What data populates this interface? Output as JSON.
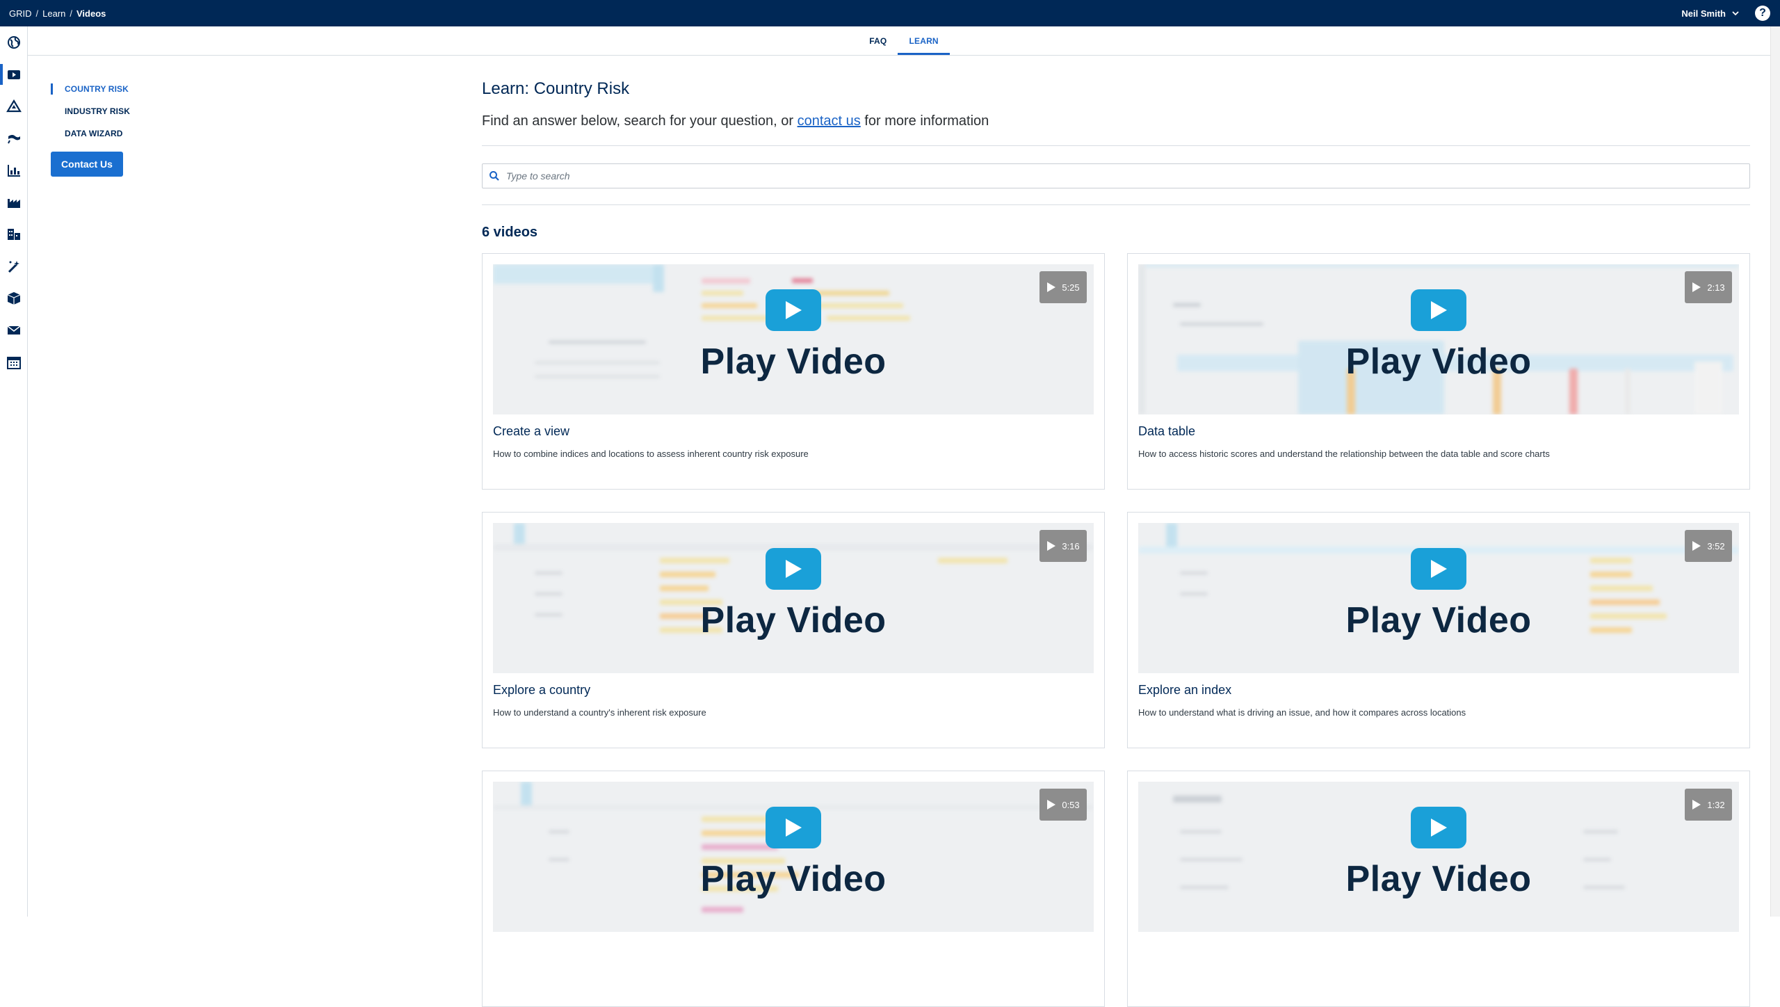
{
  "breadcrumb": {
    "items": [
      "GRID",
      "Learn",
      "Videos"
    ]
  },
  "user": {
    "name": "Neil Smith"
  },
  "help_label": "?",
  "rail": {
    "icons": [
      "globe-icon",
      "video-icon",
      "warning-triangle-icon",
      "flag-icon",
      "chart-icon",
      "factory-icon",
      "buildings-icon",
      "magic-wand-icon",
      "box-icon",
      "mail-icon",
      "calendar-icon"
    ],
    "active_index": 1
  },
  "tabs": [
    {
      "label": "FAQ",
      "active": false
    },
    {
      "label": "LEARN",
      "active": true
    }
  ],
  "sidenav": {
    "items": [
      {
        "label": "COUNTRY RISK",
        "active": true
      },
      {
        "label": "INDUSTRY RISK",
        "active": false
      },
      {
        "label": "DATA WIZARD",
        "active": false
      }
    ],
    "contact_button": "Contact Us"
  },
  "main": {
    "title": "Learn: Country Risk",
    "lede_before": "Find an answer below, search for your question, or ",
    "lede_link": "contact us",
    "lede_after": " for more information",
    "search_placeholder": "Type to search",
    "count_label": "6 videos"
  },
  "play_label": "Play Video",
  "videos": [
    {
      "title": "Create a view",
      "description": "How to combine indices and locations to assess inherent country risk exposure",
      "duration": "5:25"
    },
    {
      "title": "Data table",
      "description": "How to access historic scores and understand the relationship between the data table and score charts",
      "duration": "2:13"
    },
    {
      "title": "Explore a country",
      "description": "How to understand a country's inherent risk exposure",
      "duration": "3:16"
    },
    {
      "title": "Explore an index",
      "description": "How to understand what is driving an issue, and how it compares across locations",
      "duration": "3:52"
    },
    {
      "title": "",
      "description": "",
      "duration": "0:53"
    },
    {
      "title": "",
      "description": "",
      "duration": "1:32"
    }
  ],
  "colors": {
    "topbar": "#002856",
    "accent": "#1a63c6",
    "play": "#1aa0d8"
  }
}
